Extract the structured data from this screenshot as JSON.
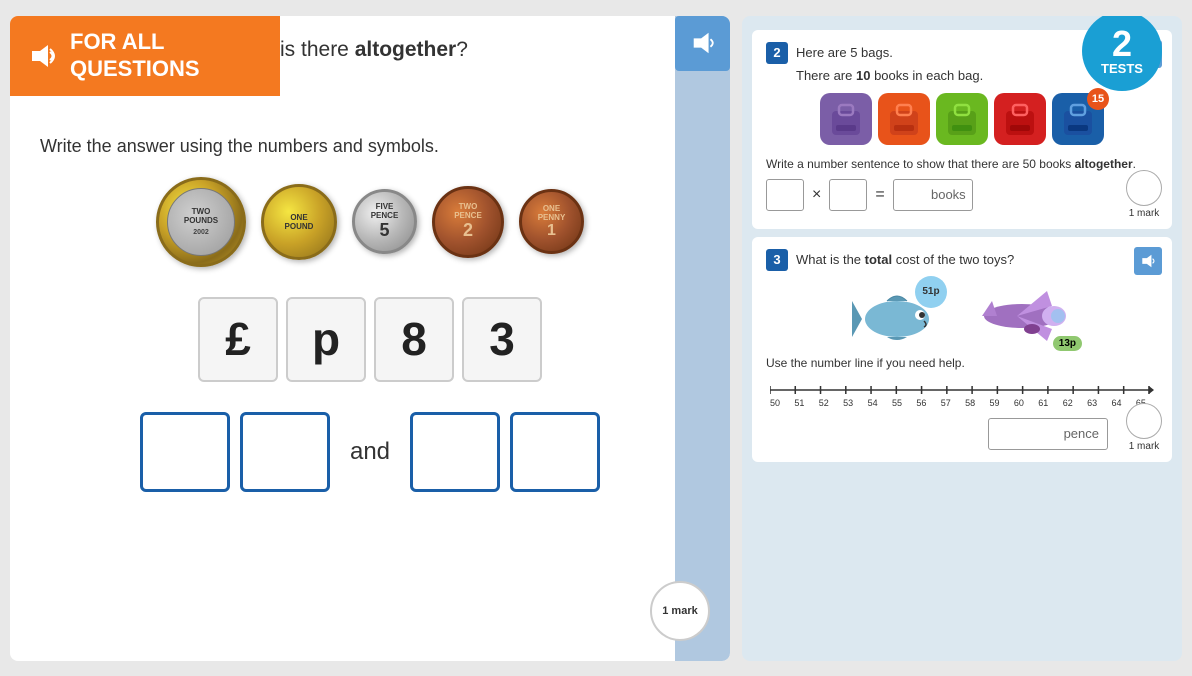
{
  "left_panel": {
    "header": {
      "line1": "FOR ALL",
      "line2": "QUESTIONS"
    },
    "question_text": "is there <b>altogether</b>?",
    "instruction": "Write the answer using the numbers and symbols.",
    "coins": [
      {
        "label": "TWO POUNDS",
        "year": "2002",
        "type": "two-pound"
      },
      {
        "label": "ONE POUND",
        "type": "one-pound"
      },
      {
        "label": "FIVE PENCE",
        "value": "5",
        "type": "five-pence"
      },
      {
        "label": "TWO PENCE",
        "value": "2",
        "type": "two-pence"
      },
      {
        "label": "ONE PENNY",
        "value": "1",
        "type": "one-penny"
      }
    ],
    "answer_display": [
      "£",
      "p",
      "8",
      "3"
    ],
    "answer_boxes": 4,
    "and_text": "and",
    "mark": "1 mark"
  },
  "right_panel": {
    "tests_badge": {
      "number": "2",
      "label": "TESTS"
    },
    "question2": {
      "number": "2",
      "title": "Here are 5 bags.",
      "subtitle": "There are 10 books in each bag.",
      "bags": [
        "purple",
        "orange",
        "green",
        "red",
        "blue-15"
      ],
      "instruction": "Write a number sentence to show that there are 50 books altogether.",
      "symbol1": "×",
      "symbol2": "=",
      "books_label": "books",
      "mark": "1 mark"
    },
    "question3": {
      "number": "3",
      "title": "What is the total cost of the two toys?",
      "toy1_price": "51p",
      "toy2_price": "13p",
      "number_line_instruction": "Use the number line if you need help.",
      "number_line_start": 50,
      "number_line_end": 65,
      "number_line_labels": [
        "50",
        "51",
        "52",
        "53",
        "54",
        "55",
        "56",
        "57",
        "58",
        "59",
        "60",
        "61",
        "62",
        "63",
        "64",
        "65"
      ],
      "answer_label": "pence",
      "mark": "1 mark"
    }
  }
}
